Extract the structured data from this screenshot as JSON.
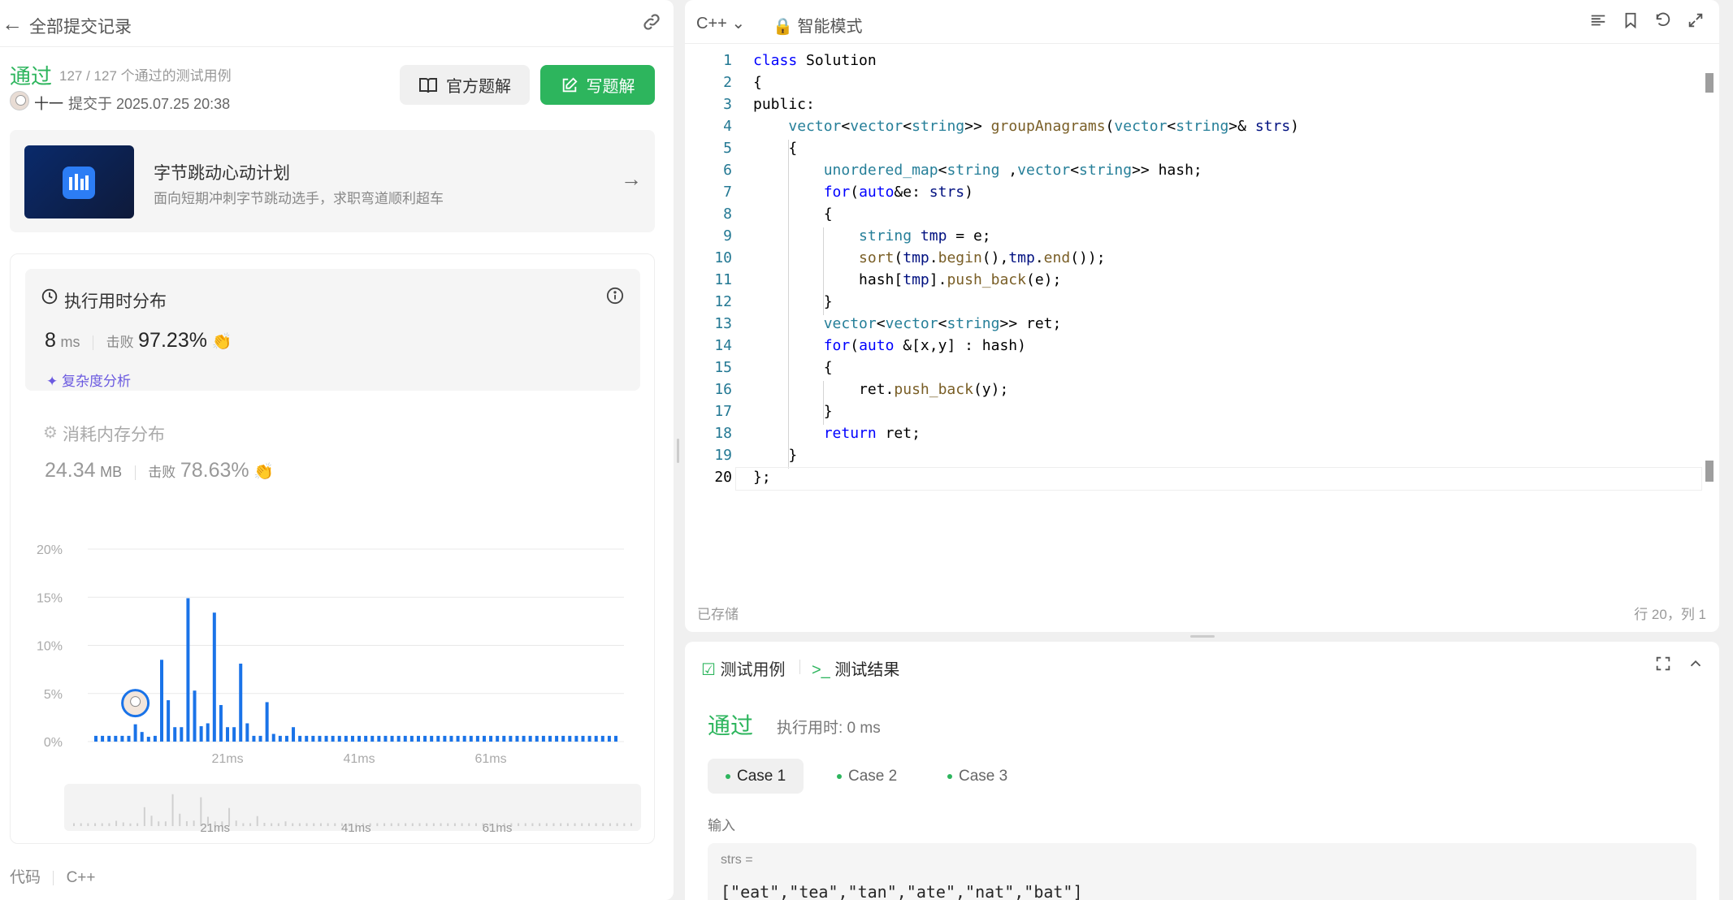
{
  "header": {
    "back_label": "全部提交记录"
  },
  "submission": {
    "status": "通过",
    "testcases": "127 / 127 个通过的测试用例",
    "user": "十一",
    "submitted_at": "提交于 2025.07.25 20:38",
    "official_solution": "官方题解",
    "write_solution": "写题解"
  },
  "promo": {
    "title": "字节跳动心动计划",
    "subtitle": "面向短期冲刺字节跳动选手，求职弯道顺利超车"
  },
  "runtime": {
    "title": "执行用时分布",
    "value": "8",
    "unit": "ms",
    "beat_label": "击败",
    "beat_value": "97.23%",
    "analysis": "复杂度分析"
  },
  "memory": {
    "title": "消耗内存分布",
    "value": "24.34",
    "unit": "MB",
    "beat_label": "击败",
    "beat_value": "78.63%"
  },
  "chart_data": {
    "type": "bar",
    "xlabel": "",
    "ylabel": "",
    "yticks": [
      "20%",
      "15%",
      "10%",
      "5%",
      "0%"
    ],
    "ylim": [
      0,
      20
    ],
    "xticks": [
      "21ms",
      "41ms",
      "61ms"
    ],
    "x": [
      1,
      2,
      3,
      4,
      5,
      6,
      7,
      8,
      9,
      10,
      11,
      12,
      13,
      14,
      15,
      16,
      17,
      18,
      19,
      20,
      21,
      22,
      23,
      24,
      25,
      26,
      27,
      28,
      29,
      30,
      31,
      32,
      33,
      34,
      35,
      36,
      37,
      38,
      39,
      40,
      41,
      42,
      43,
      44,
      45,
      46,
      47,
      48,
      49,
      50,
      51,
      52,
      53,
      54,
      55,
      56,
      57,
      58,
      59,
      60,
      61,
      62,
      63,
      64,
      65,
      66,
      67,
      68,
      69,
      70,
      71,
      72,
      73,
      74,
      75,
      76,
      77,
      78,
      79,
      80
    ],
    "values": [
      0.6,
      0.6,
      0.6,
      0.6,
      0.6,
      0.6,
      1.8,
      1.0,
      0.5,
      0.6,
      8.5,
      4.3,
      1.5,
      1.5,
      14.9,
      5.3,
      1.6,
      1.9,
      13.4,
      3.8,
      1.5,
      1.5,
      8.1,
      1.9,
      0.6,
      0.6,
      4.1,
      0.8,
      0.6,
      0.6,
      1.5,
      0.6,
      0.6,
      0.6,
      0.6,
      0.6,
      0.6,
      0.6,
      0.6,
      0.6,
      0.6,
      0.6,
      0.6,
      0.6,
      0.6,
      0.6,
      0.6,
      0.6,
      0.6,
      0.6,
      0.6,
      0.6,
      0.6,
      0.6,
      0.6,
      0.6,
      0.6,
      0.6,
      0.6,
      0.6,
      0.6,
      0.6,
      0.6,
      0.6,
      0.6,
      0.6,
      0.6,
      0.6,
      0.6,
      0.6,
      0.6,
      0.6,
      0.6,
      0.6,
      0.6,
      0.6,
      0.6,
      0.6,
      0.6,
      0.6
    ],
    "highlight_x": 8,
    "bar_color": "#1a73e8",
    "grid": true
  },
  "code_footer": {
    "label": "代码",
    "lang": "C++"
  },
  "editor": {
    "language": "C++",
    "mode": "智能模式",
    "saved": "已存储",
    "cursor": "行 20，列 1",
    "lines": [
      "class Solution",
      "{",
      "public:",
      "    vector<vector<string>> groupAnagrams(vector<string>& strs)",
      "    {",
      "        unordered_map<string ,vector<string>> hash;",
      "        for(auto&e: strs)",
      "        {",
      "            string tmp = e;",
      "            sort(tmp.begin(),tmp.end());",
      "            hash[tmp].push_back(e);",
      "        }",
      "        vector<vector<string>> ret;",
      "        for(auto &[x,y] : hash)",
      "        {",
      "            ret.push_back(y);",
      "        }",
      "        return ret;",
      "    }",
      "};"
    ]
  },
  "testpanel": {
    "tab_testcase": "测试用例",
    "tab_result": "测试结果",
    "status": "通过",
    "runtime": "执行用时: 0 ms",
    "cases": [
      "Case 1",
      "Case 2",
      "Case 3"
    ],
    "input_label": "输入",
    "param_name": "strs =",
    "param_value": "[\"eat\",\"tea\",\"tan\",\"ate\",\"nat\",\"bat\"]"
  },
  "colors": {
    "accent_green": "#2db55d",
    "bar_blue": "#1a73e8",
    "purple": "#6b5ae0"
  }
}
